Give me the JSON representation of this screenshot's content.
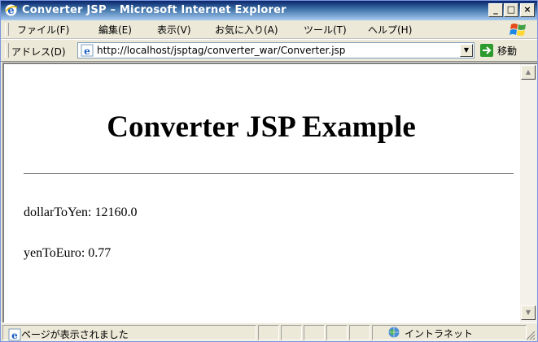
{
  "window": {
    "title": "Converter JSP – Microsoft Internet Explorer",
    "controls": {
      "minimize": "_",
      "maximize": "□",
      "close": "×"
    }
  },
  "menu": {
    "items": [
      "ファイル(F)",
      "編集(E)",
      "表示(V)",
      "お気に入り(A)",
      "ツール(T)",
      "ヘルプ(H)"
    ]
  },
  "address": {
    "label": "アドレス(D)",
    "url": "http://localhost/jsptag/converter_war/Converter.jsp",
    "go_label": "移動"
  },
  "page": {
    "heading": "Converter JSP Example",
    "results": [
      "dollarToYen: 12160.0",
      "yenToEuro: 0.77"
    ]
  },
  "status": {
    "text": "ページが表示されました",
    "zone": "イントラネット"
  },
  "colors": {
    "titlebar_start": "#0a246a",
    "titlebar_end": "#a6caf0",
    "chrome": "#ece9d8",
    "go_green": "#2d9b2d"
  },
  "icons": {
    "app": "ie-logo-icon",
    "windows": "windows-logo-icon",
    "page": "ie-page-icon",
    "go": "green-arrow-icon",
    "zone": "intranet-globe-icon"
  }
}
